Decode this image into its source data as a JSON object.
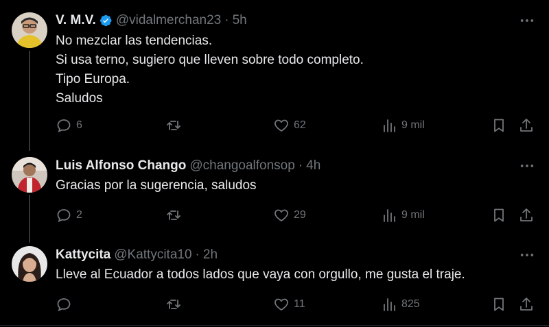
{
  "tweets": [
    {
      "name": "V. M.V.",
      "handle": "@vidalmerchan23",
      "time": "5h",
      "verified": true,
      "lines": [
        "No mezclar las tendencias.",
        "Si usa terno, sugiero que lleven sobre todo completo.",
        "Tipo Europa.",
        "Saludos"
      ],
      "replies": "6",
      "retweets": "",
      "likes": "62",
      "views": "9 mil"
    },
    {
      "name": "Luis Alfonso Chango",
      "handle": "@changoalfonsop",
      "time": "4h",
      "verified": false,
      "lines": [
        "Gracias por la sugerencia, saludos"
      ],
      "replies": "2",
      "retweets": "",
      "likes": "29",
      "views": "9 mil"
    },
    {
      "name": "Kattycita",
      "handle": "@Kattycita10",
      "time": "2h",
      "verified": false,
      "lines": [
        "Lleve al Ecuador a todos lados que vaya con orgullo, me gusta el traje."
      ],
      "replies": "",
      "retweets": "",
      "likes": "11",
      "views": "825"
    }
  ],
  "separator": "·",
  "colors": {
    "background": "#000000",
    "text": "#e7e9ea",
    "muted": "#71767b",
    "verified": "#1d9bf0",
    "thread_line": "#333639"
  }
}
